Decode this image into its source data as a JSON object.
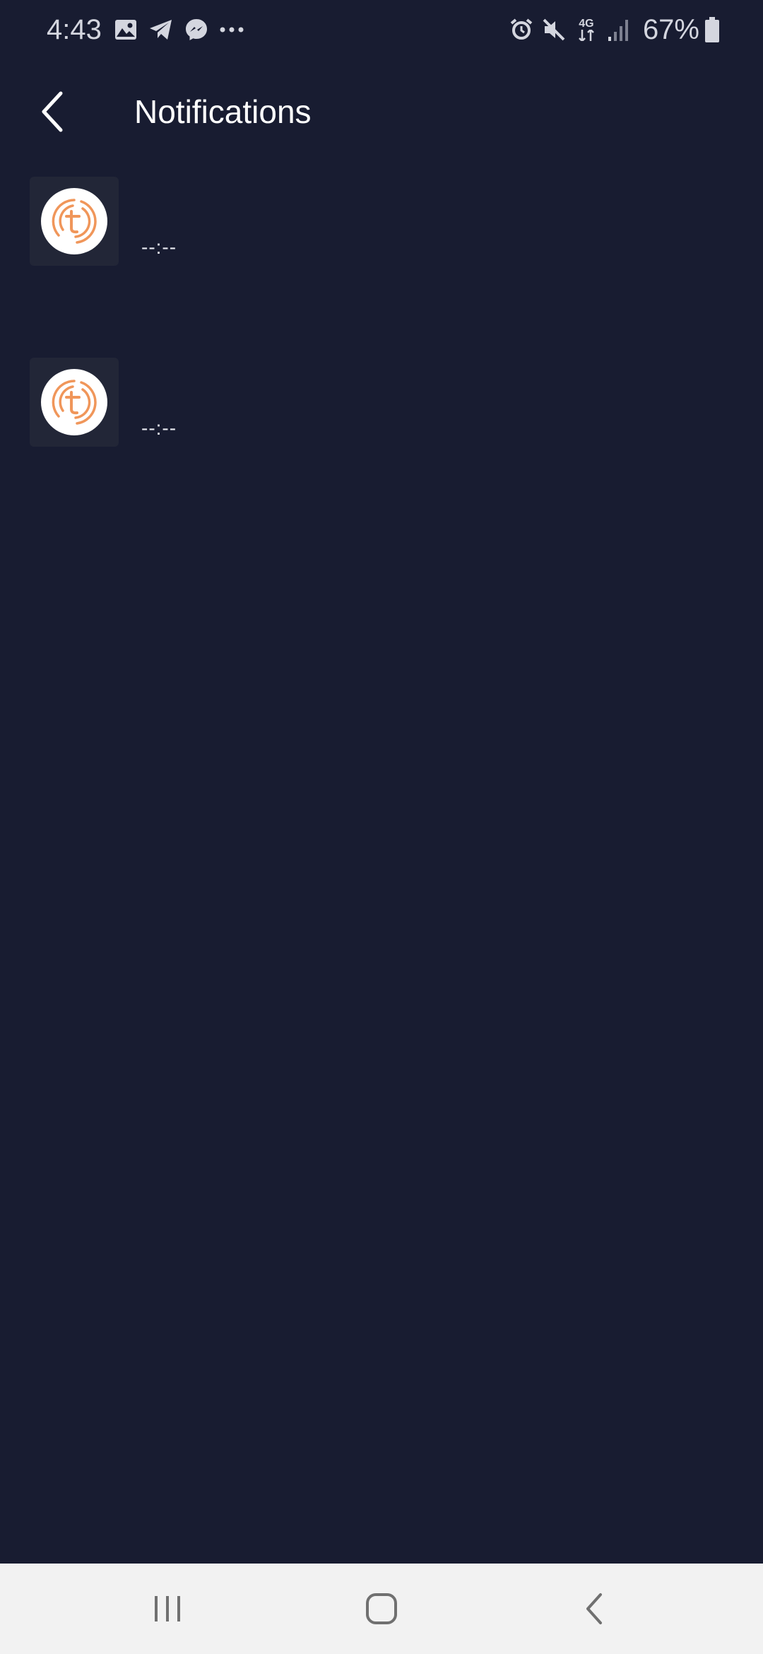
{
  "status_bar": {
    "time": "4:43",
    "network_label": "4G",
    "battery_percent": "67%",
    "left_icons": [
      "gallery-icon",
      "telegram-icon",
      "messenger-icon",
      "more-dots-icon"
    ],
    "right_icons": [
      "alarm-icon",
      "mute-icon",
      "network-4g-icon",
      "signal-icon",
      "battery-icon"
    ]
  },
  "header": {
    "title": "Notifications"
  },
  "notifications": [
    {
      "time": "--:--",
      "icon": "app-logo-icon"
    },
    {
      "time": "--:--",
      "icon": "app-logo-icon"
    }
  ],
  "nav_bar": {
    "buttons": [
      "recent-apps-icon",
      "home-icon",
      "back-icon"
    ]
  },
  "colors": {
    "background": "#181c31",
    "thumb_bg": "#222637",
    "logo_accent": "#f0965a",
    "nav_bar_bg": "#f2f2f2",
    "text": "#ffffff"
  }
}
